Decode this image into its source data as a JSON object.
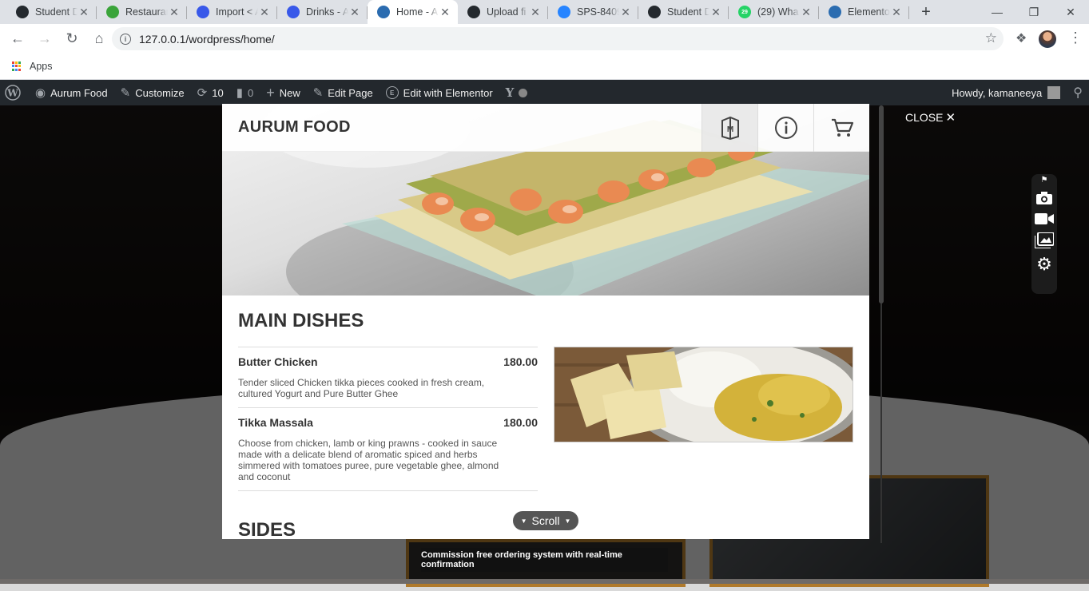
{
  "browser": {
    "tabs": [
      {
        "title": "Student D",
        "favicon": "github-icon",
        "color": "#24292e"
      },
      {
        "title": "Restaurant",
        "favicon": "leaf-icon",
        "color": "#3aa43a"
      },
      {
        "title": "Import < A",
        "favicon": "wordpress-icon",
        "color": "#3858e9"
      },
      {
        "title": "Drinks - A",
        "favicon": "wordpress-icon",
        "color": "#3858e9"
      },
      {
        "title": "Home - A",
        "favicon": "elementor-icon",
        "color": "#2b6cb0",
        "active": true
      },
      {
        "title": "Upload fi",
        "favicon": "github-icon",
        "color": "#24292e"
      },
      {
        "title": "SPS-8409",
        "favicon": "jira-icon",
        "color": "#2684ff"
      },
      {
        "title": "Student D",
        "favicon": "github-icon",
        "color": "#24292e"
      },
      {
        "title": "(29) Wha",
        "favicon": "whatsapp-icon",
        "color": "#25d366",
        "badge": "29"
      },
      {
        "title": "Elemento",
        "favicon": "elementor-icon",
        "color": "#2b6cb0"
      }
    ],
    "url": "127.0.0.1/wordpress/home/",
    "bookmarks_apps": "Apps"
  },
  "wp_admin_bar": {
    "site_name": "Aurum Food",
    "customize": "Customize",
    "updates_count": "10",
    "comments_count": "0",
    "new_label": "New",
    "edit_page": "Edit Page",
    "edit_elementor": "Edit with Elementor",
    "howdy": "Howdy, kamaneeya"
  },
  "modal": {
    "title": "AURUM FOOD",
    "section_main": "MAIN DISHES",
    "section_sides": "SIDES",
    "items": [
      {
        "name": "Butter Chicken",
        "price": "180.00",
        "description": "Tender sliced Chicken tikka pieces cooked in fresh cream, cultured Yogurt and Pure Butter Ghee"
      },
      {
        "name": "Tikka Massala",
        "price": "180.00",
        "description": "Choose from chicken, lamb or king prawns - cooked in sauce made with a delicate blend of aromatic spiced and herbs simmered with tomatoes puree, pure vegetable ghee, almond and coconut"
      }
    ],
    "scroll_label": "Scroll"
  },
  "overlay": {
    "close_label": "CLOSE",
    "tagline": "Commission free ordering system with real-time confirmation"
  },
  "colors": {
    "wp_bar": "#23282d",
    "accent_gold": "#b07a2c"
  }
}
